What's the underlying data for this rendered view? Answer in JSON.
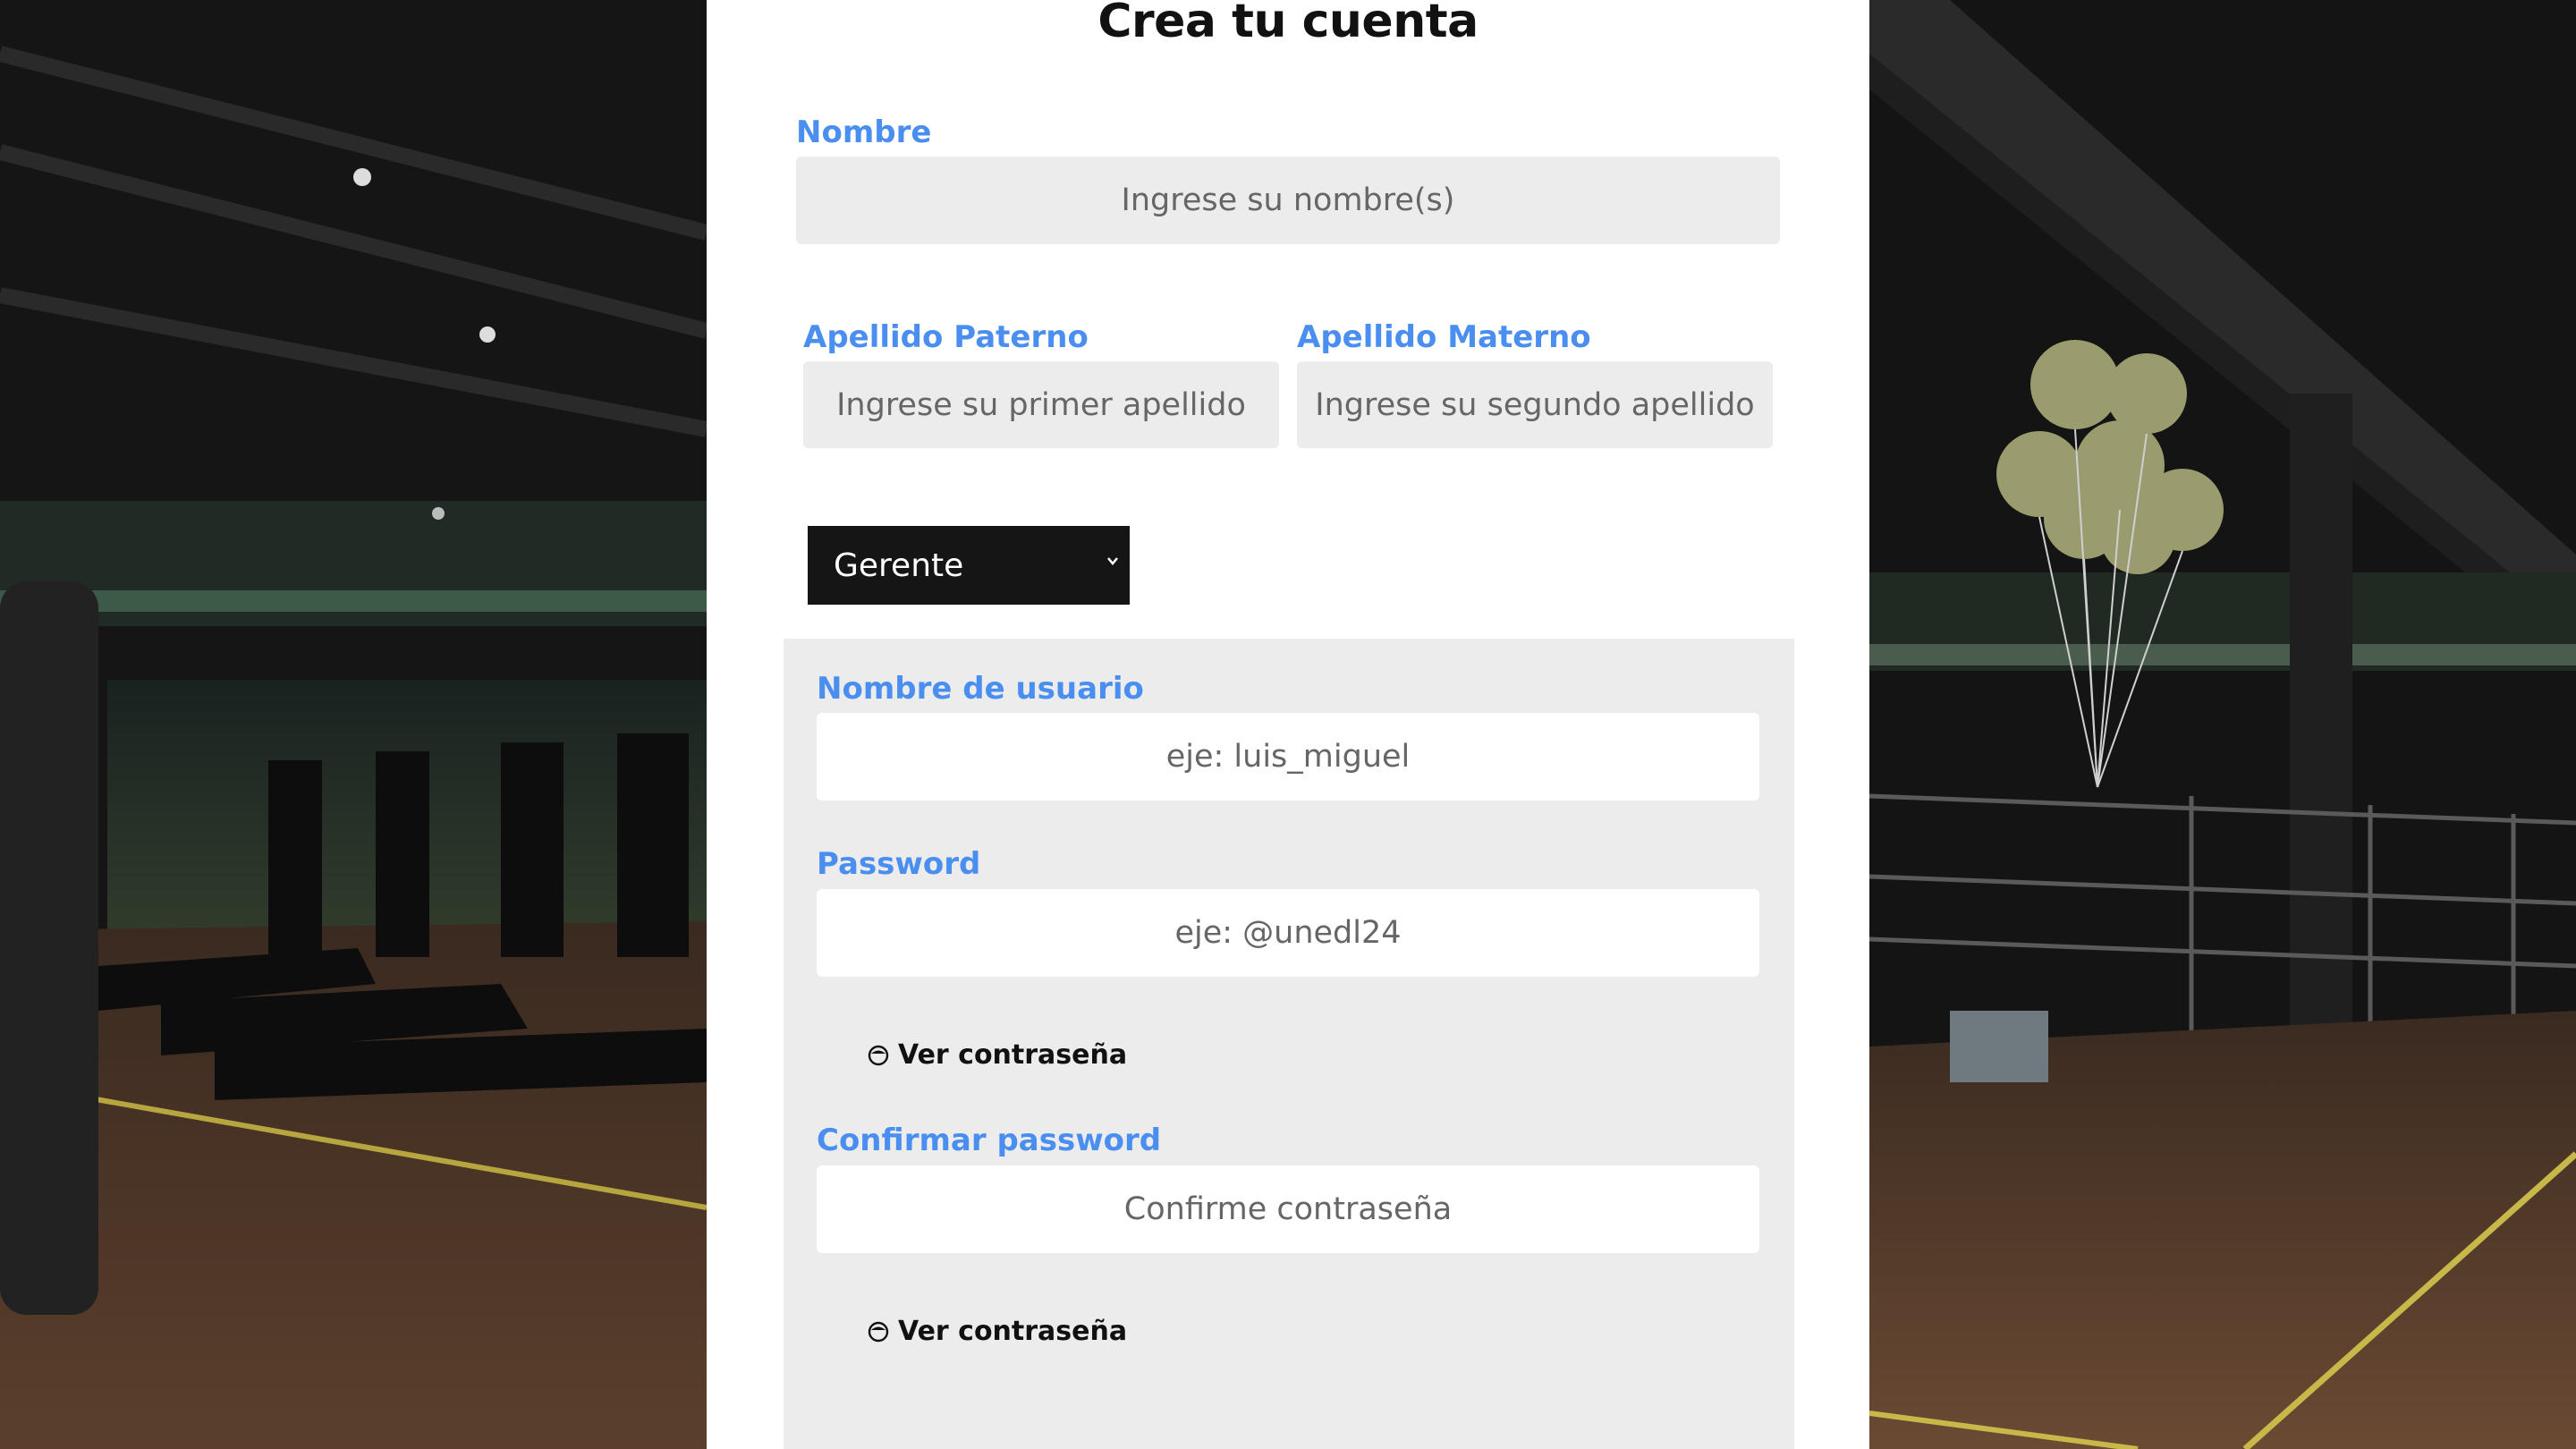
{
  "form": {
    "title": "Crea tu cuenta",
    "nombre": {
      "label": "Nombre",
      "placeholder": "Ingrese su nombre(s)"
    },
    "apellido_paterno": {
      "label": "Apellido Paterno",
      "placeholder": "Ingrese su primer apellido"
    },
    "apellido_materno": {
      "label": "Apellido Materno",
      "placeholder": "Ingrese su segundo apellido"
    },
    "role": {
      "selected": "Gerente"
    },
    "username": {
      "label": "Nombre de usuario",
      "placeholder": "eje: luis_miguel"
    },
    "password": {
      "label": "Password",
      "placeholder": "eje: @unedl24",
      "toggle": "Ver contraseña"
    },
    "confirm": {
      "label": "Confirmar password",
      "placeholder": "Confirme contraseña",
      "toggle": "Ver contraseña"
    }
  },
  "colors": {
    "label": "#4a8ff0",
    "field_bg": "#ececec",
    "select_bg": "#151515",
    "card_bg": "#ffffff"
  },
  "icons": [
    "chevron-down-icon",
    "eye-icon"
  ]
}
